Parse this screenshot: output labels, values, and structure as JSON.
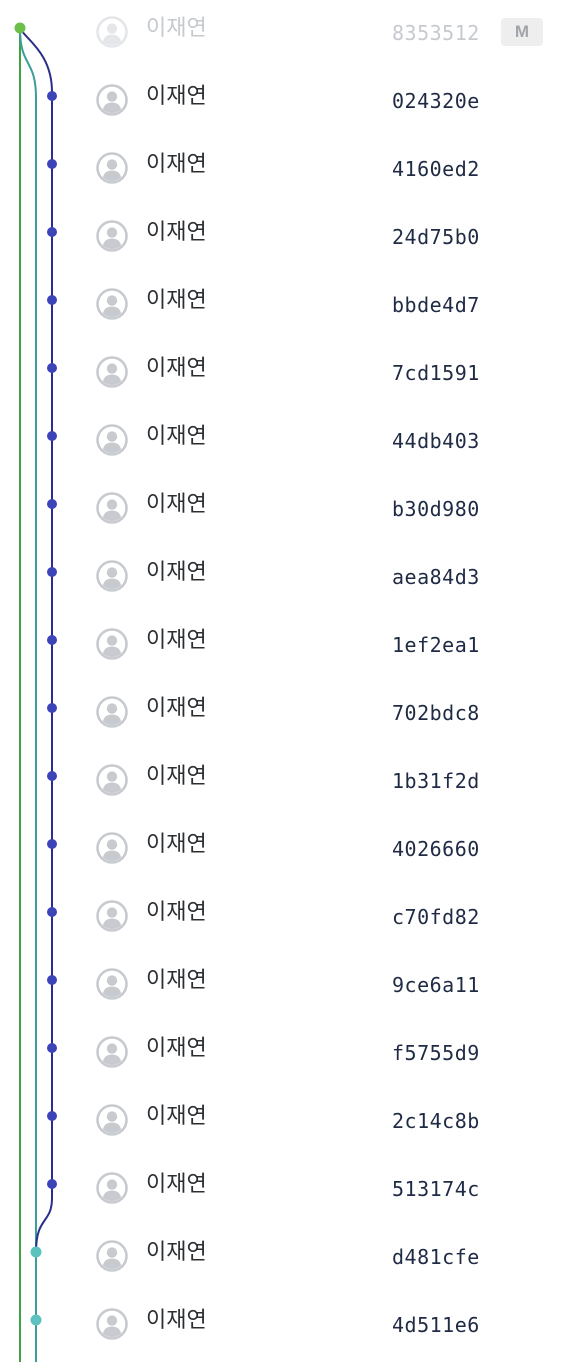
{
  "author_name": "이재연",
  "badge_label": "M",
  "colors": {
    "main_branch": "#3fa142",
    "main_dot": "#6cc04a",
    "teal_branch": "#3a9e9a",
    "teal_dot": "#5bc2be",
    "navy_branch": "#2a2f8a",
    "navy_dot": "#3d44b8",
    "avatar": "#c7cacf"
  },
  "commits": [
    {
      "hash": "8353512",
      "lane": "main",
      "faded": true,
      "badge": true
    },
    {
      "hash": "024320e",
      "lane": "navy"
    },
    {
      "hash": "4160ed2",
      "lane": "navy"
    },
    {
      "hash": "24d75b0",
      "lane": "navy"
    },
    {
      "hash": "bbde4d7",
      "lane": "navy"
    },
    {
      "hash": "7cd1591",
      "lane": "navy"
    },
    {
      "hash": "44db403",
      "lane": "navy"
    },
    {
      "hash": "b30d980",
      "lane": "navy"
    },
    {
      "hash": "aea84d3",
      "lane": "navy"
    },
    {
      "hash": "1ef2ea1",
      "lane": "navy"
    },
    {
      "hash": "702bdc8",
      "lane": "navy"
    },
    {
      "hash": "1b31f2d",
      "lane": "navy"
    },
    {
      "hash": "4026660",
      "lane": "navy"
    },
    {
      "hash": "c70fd82",
      "lane": "navy"
    },
    {
      "hash": "9ce6a11",
      "lane": "navy"
    },
    {
      "hash": "f5755d9",
      "lane": "navy"
    },
    {
      "hash": "2c14c8b",
      "lane": "navy"
    },
    {
      "hash": "513174c",
      "lane": "navy"
    },
    {
      "hash": "d481cfe",
      "lane": "teal"
    },
    {
      "hash": "4d511e6",
      "lane": "teal"
    }
  ]
}
